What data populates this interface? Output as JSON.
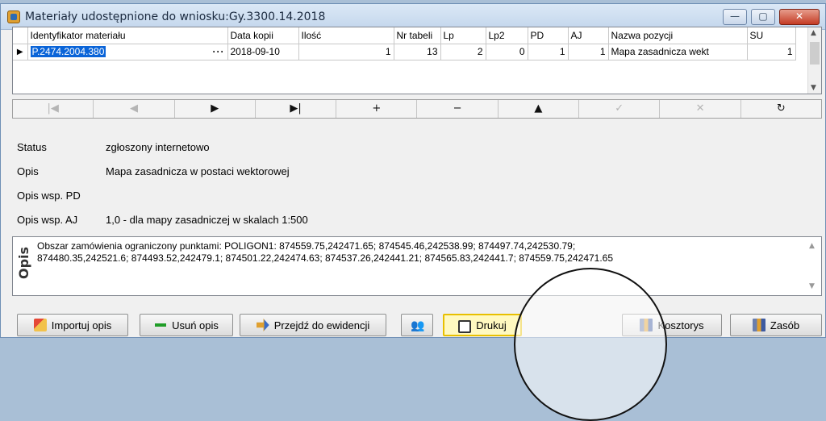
{
  "window": {
    "title": "Materiały udostępnione do wniosku:Gy.3300.14.2018"
  },
  "grid": {
    "columns": [
      "Identyfikator materiału",
      "Data kopii",
      "Ilość",
      "Nr tabeli",
      "Lp",
      "Lp2",
      "PD",
      "AJ",
      "Nazwa pozycji",
      "SU"
    ],
    "row": {
      "indicator": "▶",
      "id": "P.2474.2004.380",
      "ellipsis": "···",
      "data_kopii": "2018-09-10",
      "ilosc": "1",
      "nr_tabeli": "13",
      "lp": "2",
      "lp2": "0",
      "pd": "1",
      "aj": "1",
      "nazwa": "Mapa zasadnicza wekt",
      "su": "1"
    }
  },
  "navigator": {
    "first": "|◀",
    "prior": "◀",
    "next": "▶",
    "last": "▶|",
    "insert": "+",
    "delete": "−",
    "edit": "▲",
    "post": "✓",
    "cancel": "✕",
    "refresh": "↻"
  },
  "info": {
    "status_label": "Status",
    "status_value": "zgłoszony internetowo",
    "opis_label": "Opis",
    "opis_value": "Mapa zasadnicza w postaci wektorowej",
    "opis_pd_label": "Opis wsp. PD",
    "opis_pd_value": "",
    "opis_aj_label": "Opis wsp. AJ",
    "opis_aj_value": "1,0 - dla mapy zasadniczej w skalach 1:500"
  },
  "opis_box": {
    "side_label": "Opis",
    "line1": "Obszar zamówienia ograniczony punktami: POLIGON1: 874559.75,242471.65; 874545.46,242538.99; 874497.74,242530.79;",
    "line2": "874480.35,242521.6; 874493.52,242479.1; 874501.22,242474.63; 874537.26,242441.21; 874565.83,242441.7; 874559.75,242471.65"
  },
  "buttons": {
    "import": "Importuj opis",
    "remove": "Usuń opis",
    "goto": "Przejdź do ewidencji",
    "print": "Drukuj",
    "cost": "Kosztorys",
    "resource": "Zasób"
  },
  "icons": [
    "app-icon",
    "printer-icon",
    "import-icon",
    "minus-icon",
    "arrow-right-icon",
    "people-icon",
    "books-icon"
  ],
  "colors": {
    "selection": "#0a64d8",
    "highlight_border": "#e8c000",
    "close_button": "#c43b24"
  }
}
